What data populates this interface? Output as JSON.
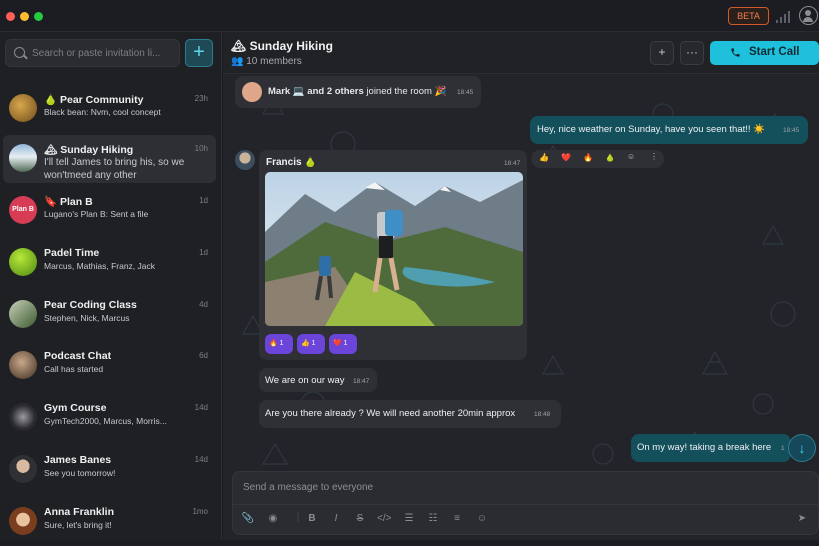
{
  "titlebar": {
    "beta": "BETA",
    "dots": [
      "#ff5f57",
      "#febc2e",
      "#28c840"
    ]
  },
  "search": {
    "placeholder": "Search or paste invitation li..."
  },
  "add_button": "+",
  "chats": [
    {
      "name": "🍐 Pear Community",
      "preview": "Black bean: Nvm, cool concept",
      "time": "23h",
      "avatar": "#a0762e"
    },
    {
      "name": "🏔 Sunday Hiking",
      "preview": "I'll tell James to bring his, so we won'tmeed any other",
      "time": "10h",
      "avatar": "#5b7fa0"
    },
    {
      "name": "🔖 Plan B",
      "preview": "Lugano's Plan B: Sent a file",
      "time": "1d",
      "avatar": "#d83c55"
    },
    {
      "name": "Padel Time",
      "preview": "Marcus, Mathias, Franz, Jack",
      "time": "1d",
      "avatar": "#7bbd2a"
    },
    {
      "name": "Pear Coding Class",
      "preview": "Stephen, Nick, Marcus",
      "time": "4d",
      "avatar": "#4a6b3a"
    },
    {
      "name": "Podcast Chat",
      "preview": "Call has started",
      "time": "6d",
      "avatar": "#5c4a3a"
    },
    {
      "name": "Gym Course",
      "preview": "GymTech2000, Marcus, Morris...",
      "time": "14d",
      "avatar": "#2a2a2e"
    },
    {
      "name": "James Banes",
      "preview": "See you tomorrow!",
      "time": "14d",
      "avatar": "#3a3c40"
    },
    {
      "name": "Anna Franklin",
      "preview": "Sure, let's bring it!",
      "time": "1mo",
      "avatar": "#b06a42"
    }
  ],
  "header": {
    "title": "🏔 Sunday Hiking",
    "members": "10 members",
    "call": "Start Call",
    "add_member": "+",
    "more": "···"
  },
  "join": {
    "name": "Mark",
    "text": "💻 and 2 others",
    "rest": "joined the room 🎉",
    "time": "18:45"
  },
  "messages": {
    "m1": {
      "text": "Hey, nice weather on Sunday, have you seen that!! ☀️",
      "time": "18:45"
    },
    "francis": {
      "name": "Francis 🍐",
      "time": "18:47"
    },
    "reactions": [
      {
        "emoji": "🔥",
        "count": "1"
      },
      {
        "emoji": "👍",
        "count": "1"
      },
      {
        "emoji": "❤️",
        "count": "1"
      }
    ],
    "m3": {
      "text": "We are on our way",
      "time": "18:47"
    },
    "m4": {
      "text": "Are you there already ? We will need another 20min approx",
      "time": "18:48"
    },
    "m5": {
      "text": "On my way! taking a break here",
      "time": "1"
    }
  },
  "reactbar": [
    "👍",
    "❤️",
    "🔥",
    "🍐",
    "☺",
    "⋮"
  ],
  "composer": {
    "placeholder": "Send a message to everyone"
  }
}
